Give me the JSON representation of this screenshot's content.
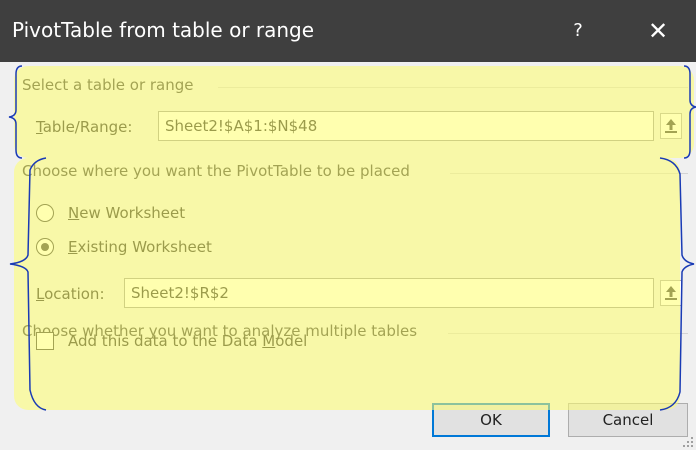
{
  "dialog": {
    "title": "PivotTable from table or range",
    "help_label": "?",
    "close_label": "✕"
  },
  "section1": {
    "heading": "Select a table or range",
    "range_label_accel": "T",
    "range_label_rest": "able/Range:",
    "range_value": "Sheet2!$A$1:$N$48"
  },
  "section2": {
    "heading": "Choose where you want the PivotTable to be placed",
    "new_worksheet_accel": "N",
    "new_worksheet_rest": "ew Worksheet",
    "existing_worksheet_accel": "E",
    "existing_worksheet_rest": "xisting Worksheet",
    "selected_option": "Existing Worksheet",
    "location_label_accel": "L",
    "location_label_rest": "ocation:",
    "location_value": "Sheet2!$R$2"
  },
  "section3": {
    "heading": "Choose whether you want to analyze multiple tables",
    "data_model_label_pre": "Add this data to the Data ",
    "data_model_label_accel": "M",
    "data_model_label_post": "odel",
    "data_model_checked": false
  },
  "buttons": {
    "ok_label": "OK",
    "cancel_label": "Cancel"
  },
  "colors": {
    "titlebar": "#3f3f3f",
    "highlight": "#ffff6e",
    "brace": "#1a3bb5",
    "default_button_border": "#0078d7"
  },
  "icons": {
    "collapse": "collapse-dialog-icon",
    "resize": "resize-grip-icon"
  }
}
